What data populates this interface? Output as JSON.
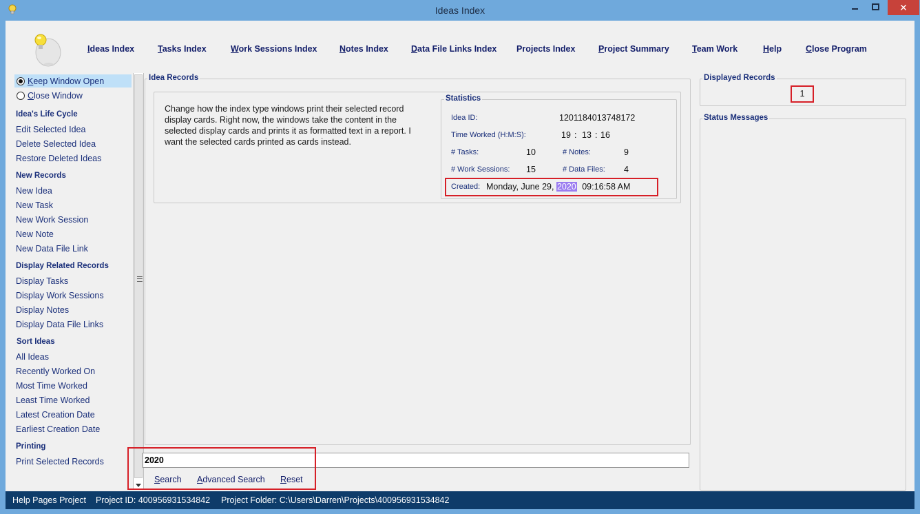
{
  "window": {
    "title": "Ideas Index",
    "close_glyph": "✕",
    "min_glyph": "—",
    "max_glyph": "☐"
  },
  "topnav": [
    {
      "first": "I",
      "rest": "deas Index"
    },
    {
      "first": "T",
      "rest": "asks Index"
    },
    {
      "first": "W",
      "rest": "ork Sessions Index"
    },
    {
      "first": "N",
      "rest": "otes Index"
    },
    {
      "first": "D",
      "rest": "ata File Links Index"
    },
    {
      "first": "P",
      "rest": "rojects Index"
    },
    {
      "first": "P",
      "rest": "roject Summary"
    },
    {
      "first": "T",
      "rest": "eam Work"
    },
    {
      "first": "H",
      "rest": "elp"
    },
    {
      "first": "C",
      "rest": "lose Program"
    }
  ],
  "sidebar": {
    "keep_open_first": "K",
    "keep_open_rest": "eep Window Open",
    "close_first": "C",
    "close_rest": "lose Window",
    "sections": [
      {
        "title": "Idea's Life Cycle",
        "items": [
          "Edit Selected Idea",
          "Delete Selected Idea",
          "Restore Deleted Ideas"
        ]
      },
      {
        "title": "New Records",
        "items": [
          "New Idea",
          "New Task",
          "New Work Session",
          "New Note",
          "New Data File Link"
        ]
      },
      {
        "title": "Display Related Records",
        "items": [
          "Display Tasks",
          "Display Work Sessions",
          "Display Notes",
          "Display Data File Links"
        ]
      },
      {
        "title": "Sort Ideas",
        "items": [
          "All Ideas",
          "Recently Worked On",
          "Most Time Worked",
          "Least Time Worked",
          "Latest Creation Date",
          "Earliest Creation Date"
        ]
      },
      {
        "title": "Printing",
        "items": [
          "Print Selected Records"
        ]
      }
    ]
  },
  "idea_records": {
    "label": "Idea Records",
    "description": "Change how the index type windows print their selected record display cards. Right now, the windows take the content in the selected display cards and prints it as formatted text in a report. I want the selected cards printed as cards instead.",
    "statistics": {
      "label": "Statistics",
      "idea_id_label": "Idea ID:",
      "idea_id": "1201184013748172",
      "time_worked_label": "Time Worked (H:M:S):",
      "time_h": "19",
      "time_m": "13",
      "time_s": "16",
      "sep": ":",
      "tasks_label": "# Tasks:",
      "tasks": "10",
      "notes_label": "# Notes:",
      "notes": "9",
      "sessions_label": "# Work Sessions:",
      "sessions": "15",
      "files_label": "# Data Files:",
      "files": "4",
      "created_label": "Created:",
      "created_pre": "Monday, June 29,",
      "created_highlight": "2020",
      "created_post": "09:16:58 AM"
    }
  },
  "search": {
    "value": "2020",
    "search_first": "S",
    "search_rest": "earch",
    "advanced_first": "A",
    "advanced_rest": "dvanced Search",
    "reset_first": "R",
    "reset_rest": "eset"
  },
  "displayed_records": {
    "label": "Displayed Records",
    "count": "1"
  },
  "status_messages": {
    "label": "Status Messages"
  },
  "statusbar": {
    "project": "Help Pages Project",
    "project_id": "Project ID:  400956931534842",
    "folder": "Project Folder:  C:\\Users\\Darren\\Projects\\400956931534842"
  },
  "colors": {
    "accent_red": "#d61f27",
    "title_blue": "#6fa9dc",
    "status_navy": "#0e3c6a",
    "highlight": "#9b7cf0"
  }
}
